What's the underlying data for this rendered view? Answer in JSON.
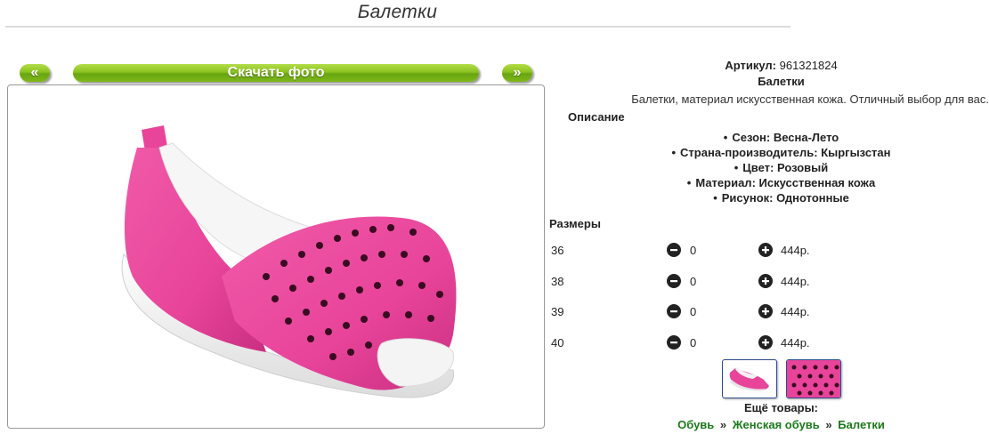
{
  "page": {
    "title": "Балетки"
  },
  "gallery": {
    "prev_label": "«",
    "download_label": "Скачать фото",
    "next_label": "»"
  },
  "product": {
    "article_label": "Артикул:",
    "article_value": "961321824",
    "name": "Балетки",
    "description": "Балетки, материал искусственная кожа. Отличный выбор для вас.",
    "description_heading": "Описание",
    "properties": [
      "Сезон: Весна-Лето",
      "Страна-производитель: Кыргызстан",
      "Цвет: Розовый",
      "Материал: Искусственная кожа",
      "Рисунок: Однотонные"
    ]
  },
  "sizes": {
    "heading": "Размеры",
    "rows": [
      {
        "size": "36",
        "qty": "0",
        "price": "444р."
      },
      {
        "size": "38",
        "qty": "0",
        "price": "444р."
      },
      {
        "size": "39",
        "qty": "0",
        "price": "444р."
      },
      {
        "size": "40",
        "qty": "0",
        "price": "444р."
      }
    ]
  },
  "more": {
    "label": "Ещё товары:",
    "breadcrumb": [
      "Обувь",
      "Женская обувь",
      "Балетки"
    ],
    "separator": "»"
  },
  "colors": {
    "accent_green": "#7fb818",
    "link_green": "#1b7a1b",
    "shoe_pink": "#e8449a",
    "thumb_border": "#2a4d8f"
  },
  "icons": {
    "minus": "minus-circle-icon",
    "plus": "plus-circle-icon"
  }
}
